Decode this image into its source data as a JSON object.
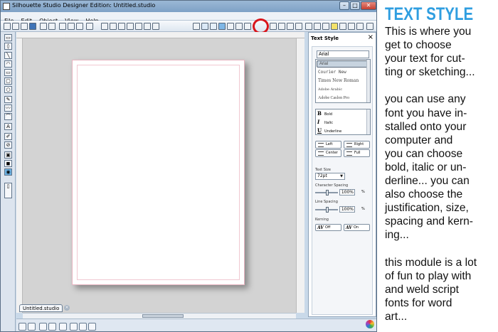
{
  "window": {
    "title": "Silhouette Studio Designer Edition: Untitled.studio",
    "minimize": "–",
    "maximize": "□",
    "close": "✕"
  },
  "menu": [
    "File",
    "Edit",
    "Object",
    "View",
    "Help"
  ],
  "toolbar": {
    "text_style_glyph": "A"
  },
  "left_tools": [
    "▭",
    "◊",
    "╲",
    "◠",
    "▭",
    "▢",
    "○",
    "✎",
    "〰",
    "⌒",
    "A",
    "✐",
    "⊘",
    "▣",
    "◼",
    "◉",
    "▯"
  ],
  "canvas": {
    "background": "#d3d3d3",
    "page_border": "#e7b4c0"
  },
  "document_tab": {
    "label": "Untitled.studio",
    "close": "×"
  },
  "panel": {
    "title": "Text Style",
    "close": "×",
    "font_field": "Arial",
    "fonts": [
      "Arial",
      "Courier New",
      "Times New Roman",
      "Adobe Arabic",
      "Adobe Caslon Pro"
    ],
    "format": {
      "bold": "Bold",
      "italic": "Italic",
      "underline": "Underline",
      "bold_icon": "B",
      "italic_icon": "I",
      "underline_icon": "U"
    },
    "justify": {
      "left": "Left",
      "right": "Right",
      "center": "Center",
      "full": "Full"
    },
    "text_size_label": "Text Size",
    "text_size": "72pt",
    "char_spacing_label": "Character Spacing",
    "char_spacing": "100%",
    "line_spacing_label": "Line Spacing",
    "line_spacing": "100%",
    "percent": "%",
    "kerning_label": "Kerning",
    "kerning_off": "Off",
    "kerning_on": "On",
    "kerning_icon": "AV"
  },
  "annotation": {
    "title": "TEXT STYLE",
    "title_color": "#2f9ee0",
    "highlight_color": "#d8151b",
    "text": "This is where you\nget to choose\nyour text for cut-\nting or sketching...\n\nyou can use any\nfont you have in-\nstalled onto your\ncomputer and\nyou can choose\nbold, italic or un-\nderline... you can\nalso choose the\njustification, size,\nspacing and kern-\ning...\n\nthis module is a lot\nof fun to play with\nand weld script\nfonts for word\nart..."
  }
}
